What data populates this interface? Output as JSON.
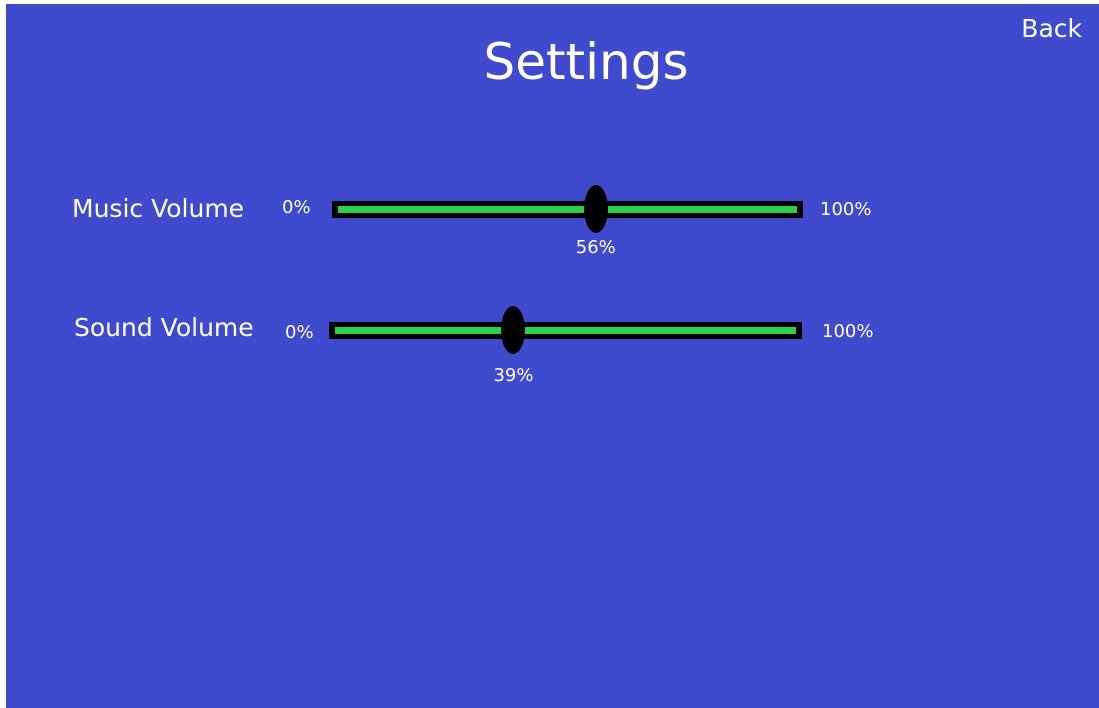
{
  "screen": {
    "title": "Settings",
    "back_label": "Back",
    "background_color": "#3f4acf"
  },
  "settings": [
    {
      "label": "Music Volume",
      "min_label": "0%",
      "max_label": "100%",
      "value": 56,
      "value_label": "56%"
    },
    {
      "label": "Sound Volume",
      "min_label": "0%",
      "max_label": "100%",
      "value": 39,
      "value_label": "39%"
    }
  ],
  "colors": {
    "track": "#000000",
    "track_fill": "#2bd14d",
    "thumb": "#000000"
  }
}
